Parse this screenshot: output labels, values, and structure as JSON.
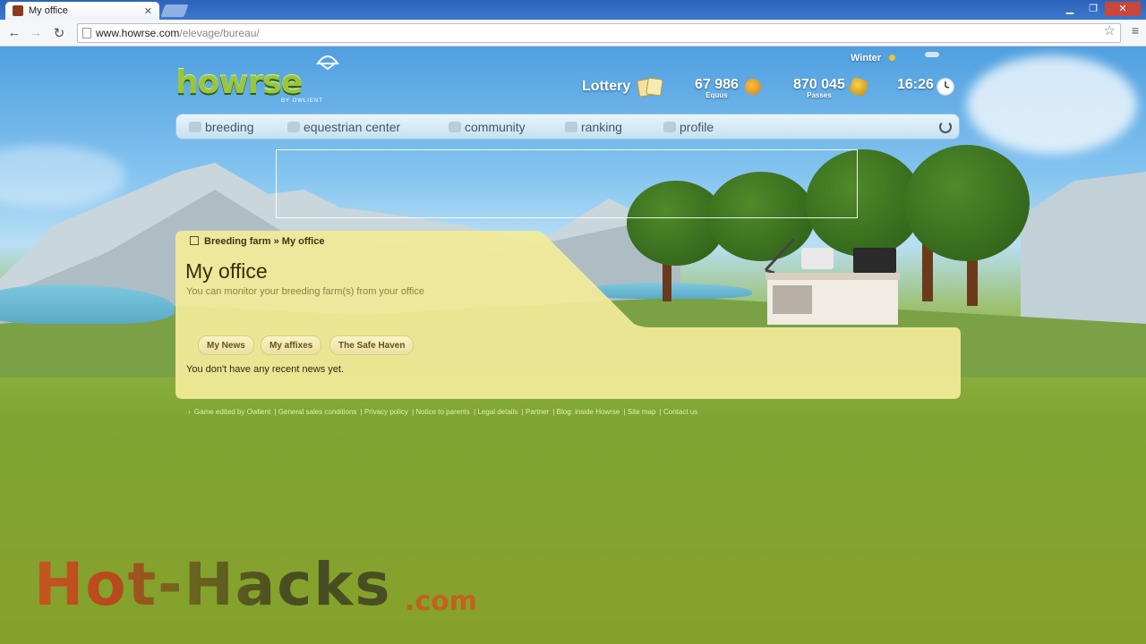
{
  "browser": {
    "tab_title": "My office",
    "url_host": "www.howrse.com",
    "url_path": "/elevage/bureau/",
    "icons": {
      "back": "back-arrow-icon",
      "forward": "forward-arrow-icon",
      "reload": "reload-icon",
      "bookmark": "star-icon",
      "menu": "menu-icon"
    }
  },
  "header": {
    "logo": "howrse",
    "logo_by": "BY OWLIENT",
    "season": "Winter",
    "lottery_label": "Lottery",
    "equus_value": "67 986",
    "equus_label": "Equus",
    "passes_value": "870 045",
    "passes_label": "Passes",
    "time": "16:26"
  },
  "nav": {
    "items": [
      {
        "label": "breeding"
      },
      {
        "label": "equestrian center"
      },
      {
        "label": "community"
      },
      {
        "label": "ranking"
      },
      {
        "label": "profile"
      }
    ]
  },
  "main": {
    "breadcrumb": "Breeding farm » My office",
    "title": "My office",
    "subtitle": "You can monitor your breeding farm(s) from your office",
    "tabs": [
      {
        "label": "My News"
      },
      {
        "label": "My affixes"
      },
      {
        "label": "The Safe Haven"
      }
    ],
    "empty_message": "You don't have any recent news yet."
  },
  "footer": {
    "links": [
      "Game edited by Owlient",
      "General sales conditions",
      "Privacy policy",
      "Notice to parents",
      "Legal details",
      "Partner",
      "Blog: inside Howrse",
      "Site map",
      "Contact us"
    ]
  },
  "watermark": {
    "main": "Hot-Hacks",
    "suffix": ".com"
  },
  "colors": {
    "panel": "#f2eb98",
    "nav": "#d6eaf7",
    "accent_logo": "#9bc63b"
  }
}
